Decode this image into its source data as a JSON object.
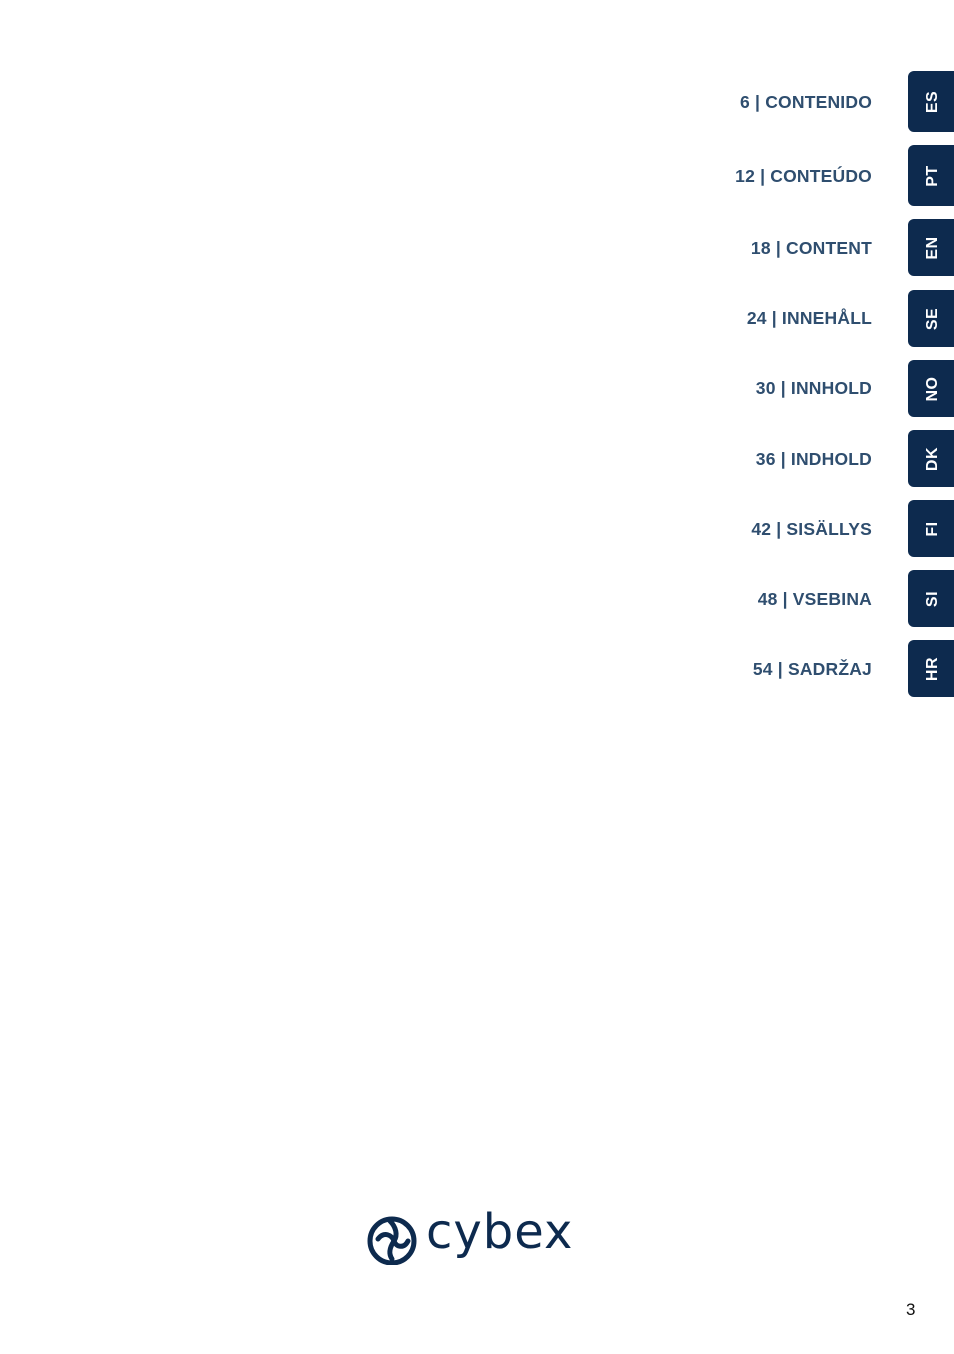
{
  "toc": [
    {
      "page": "6",
      "title": "CONTENIDO",
      "lang": "ES",
      "label": "6 | CONTENIDO"
    },
    {
      "page": "12",
      "title": "CONTEÚDO",
      "lang": "PT",
      "label": "12 | CONTEÚDO"
    },
    {
      "page": "18",
      "title": "CONTENT",
      "lang": "EN",
      "label": "18 | CONTENT"
    },
    {
      "page": "24",
      "title": "INNEHÅLL",
      "lang": "SE",
      "label": "24 | INNEHÅLL"
    },
    {
      "page": "30",
      "title": "INNHOLD",
      "lang": "NO",
      "label": "30 | INNHOLD"
    },
    {
      "page": "36",
      "title": "INDHOLD",
      "lang": "DK",
      "label": "36 | INDHOLD"
    },
    {
      "page": "42",
      "title": "SISÄLLYS",
      "lang": "FI",
      "label": "42 | SISÄLLYS"
    },
    {
      "page": "48",
      "title": "VSEBINA",
      "lang": "SI",
      "label": "48 | VSEBINA"
    },
    {
      "page": "54",
      "title": "SADRŽAJ",
      "lang": "HR",
      "label": "54 | SADRŽAJ"
    }
  ],
  "brand": {
    "name": "cybex",
    "color": "#0d2a4e"
  },
  "colors": {
    "toc_text": "#2f4e6f",
    "tab_bg": "#0d2a4e"
  },
  "page_number": "3"
}
